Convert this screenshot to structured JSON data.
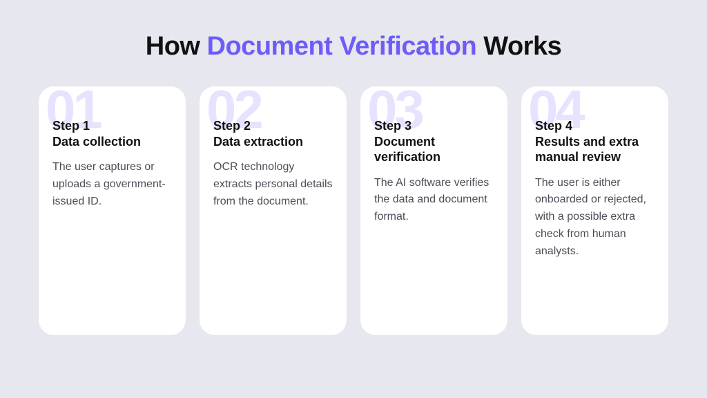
{
  "title": {
    "pre": "How ",
    "accent": "Document Verification",
    "post": " Works"
  },
  "steps": [
    {
      "num": "01",
      "label": "Step 1",
      "title": "Data collection",
      "desc": "The user captures or uploads a government-issued ID."
    },
    {
      "num": "02",
      "label": "Step 2",
      "title": "Data extraction",
      "desc": "OCR technology extracts personal details from the document."
    },
    {
      "num": "03",
      "label": "Step 3",
      "title": "Document verification",
      "desc": "The AI software verifies the data and document format."
    },
    {
      "num": "04",
      "label": "Step 4",
      "title": "Results and extra manual review",
      "desc": "The user is either onboarded or rejected, with a possible extra check from human analysts."
    }
  ]
}
